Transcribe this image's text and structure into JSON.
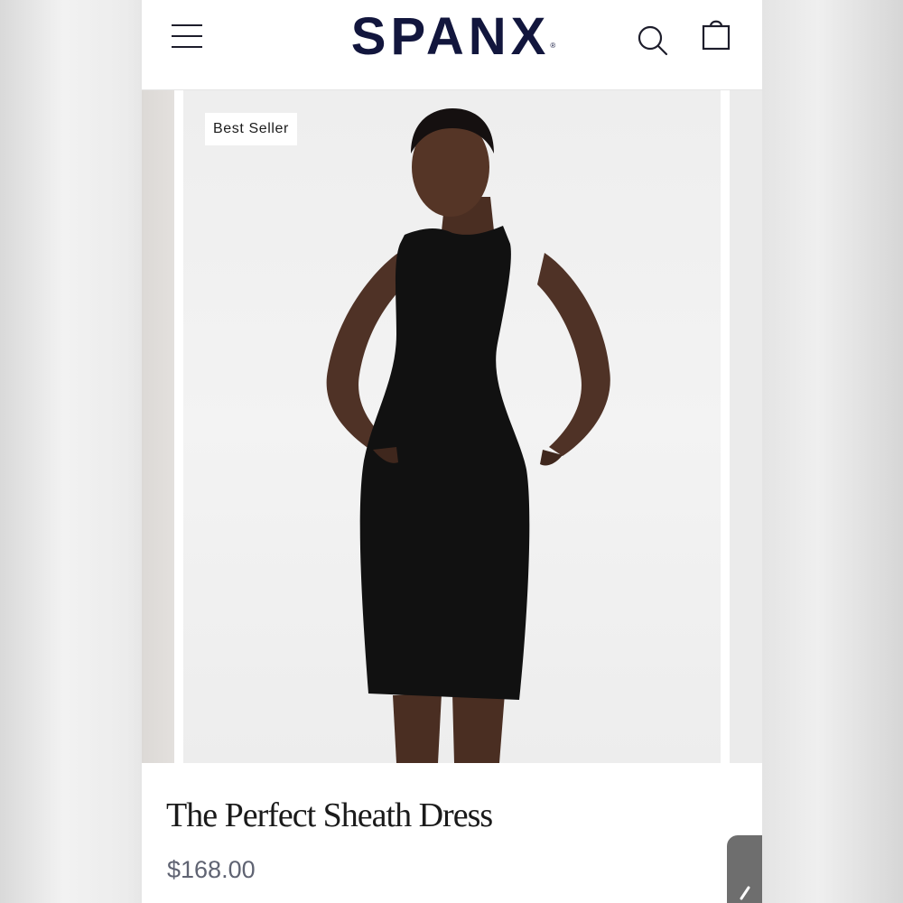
{
  "header": {
    "logo_text": "SPANX",
    "logo_mark": "®",
    "menu_icon": "hamburger-menu-icon",
    "search_icon": "search-icon",
    "bag_icon": "shopping-bag-icon"
  },
  "carousel": {
    "badge": "Best Seller",
    "image_subject": "model wearing black sleeveless sheath dress"
  },
  "product": {
    "title": "The Perfect Sheath Dress",
    "price": "$168.00"
  },
  "chat": {
    "icon": "chat-icon"
  },
  "colors": {
    "brand_navy": "#12163d",
    "price_gray": "#5f6372",
    "dress_black": "#111111"
  }
}
